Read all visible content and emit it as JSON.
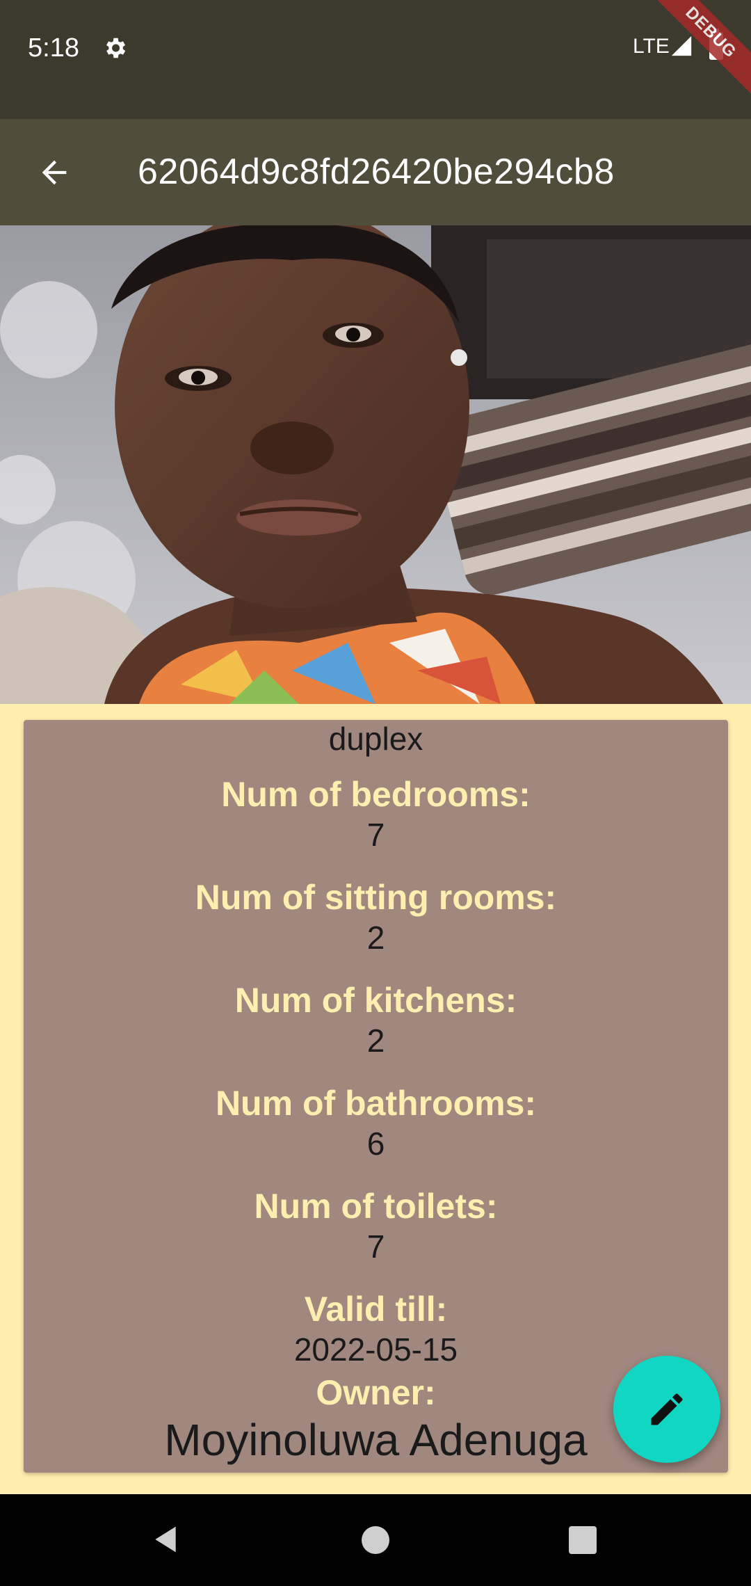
{
  "status_bar": {
    "time": "5:18",
    "network": "LTE",
    "icons": [
      "gear-icon",
      "signal-icon",
      "battery-icon"
    ]
  },
  "debug_banner": "DEBUG",
  "app_bar": {
    "title": "62064d9c8fd26420be294cb8",
    "back_icon": "arrow-back-icon"
  },
  "details": {
    "house_type": "duplex",
    "bedrooms_label": "Num of bedrooms:",
    "bedrooms": "7",
    "sitting_rooms_label": "Num of sitting rooms:",
    "sitting_rooms": "2",
    "kitchens_label": "Num of kitchens:",
    "kitchens": "2",
    "bathrooms_label": "Num of bathrooms:",
    "bathrooms": "6",
    "toilets_label": "Num of toilets:",
    "toilets": "7",
    "valid_till_label": "Valid till:",
    "valid_till": "2022-05-15",
    "owner_label": "Owner:",
    "owner": "Moyinoluwa Adenuga"
  },
  "fab": {
    "icon": "pencil-edit-icon"
  },
  "colors": {
    "status_bar": "#3C3A2C",
    "app_bar": "#504E3A",
    "background": "#FFEEB0",
    "card": "#A1887F",
    "label": "#FFEEB0",
    "fab": "#12D6C4"
  }
}
